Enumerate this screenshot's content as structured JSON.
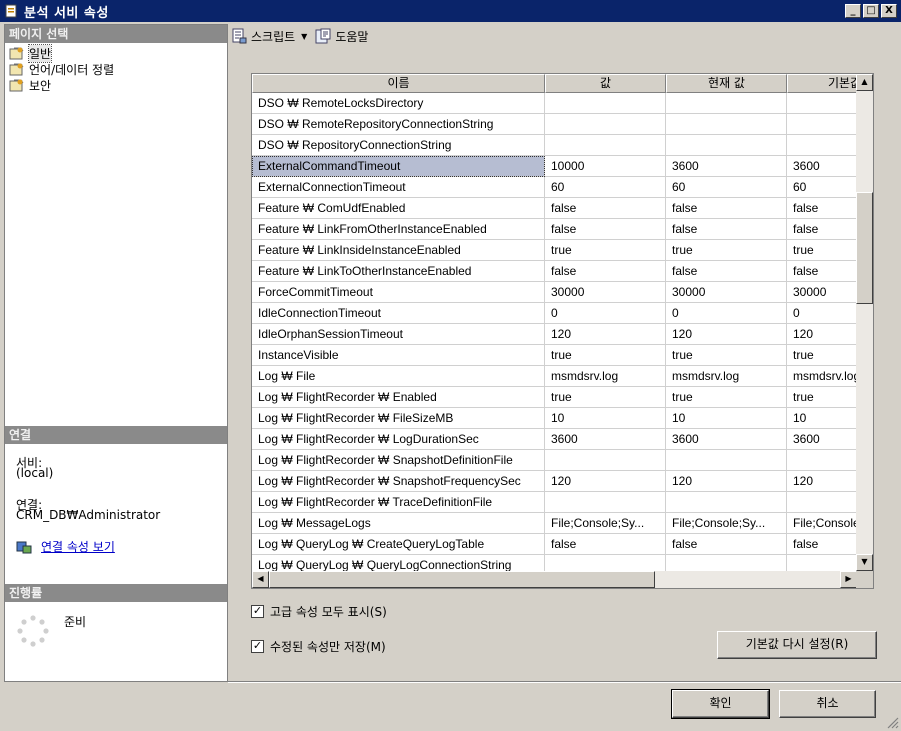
{
  "window": {
    "title": "분석 서비 속성",
    "minimize": "_",
    "maximize": "□",
    "close": "X"
  },
  "left": {
    "pages_header": "페이지 선택",
    "pages": [
      {
        "label": "일반",
        "icon": "property-page-icon"
      },
      {
        "label": "언어/데이터 정렬",
        "icon": "property-page-icon"
      },
      {
        "label": "보안",
        "icon": "property-page-icon"
      }
    ],
    "connection_header": "연결",
    "server_label": "서비:",
    "server_value": "(local)",
    "connection_label": "연결:",
    "connection_value": "CRM_DB₩Administrator",
    "view_connection_link": "연결 속성 보기",
    "progress_header": "진행률",
    "progress_status": "준비"
  },
  "toolbar": {
    "script_label": "스크립트",
    "help_label": "도움말"
  },
  "grid": {
    "columns": [
      "이름",
      "값",
      "현재 값",
      "기본값"
    ],
    "rows": [
      [
        "DSO ₩ RemoteLocksDirectory",
        "",
        "",
        ""
      ],
      [
        "DSO ₩ RemoteRepositoryConnectionString",
        "",
        "",
        ""
      ],
      [
        "DSO ₩ RepositoryConnectionString",
        "",
        "",
        ""
      ],
      [
        "ExternalCommandTimeout",
        "10000",
        "3600",
        "3600"
      ],
      [
        "ExternalConnectionTimeout",
        "60",
        "60",
        "60"
      ],
      [
        "Feature ₩ ComUdfEnabled",
        "false",
        "false",
        "false"
      ],
      [
        "Feature ₩ LinkFromOtherInstanceEnabled",
        "false",
        "false",
        "false"
      ],
      [
        "Feature ₩ LinkInsideInstanceEnabled",
        "true",
        "true",
        "true"
      ],
      [
        "Feature ₩ LinkToOtherInstanceEnabled",
        "false",
        "false",
        "false"
      ],
      [
        "ForceCommitTimeout",
        "30000",
        "30000",
        "30000"
      ],
      [
        "IdleConnectionTimeout",
        "0",
        "0",
        "0"
      ],
      [
        "IdleOrphanSessionTimeout",
        "120",
        "120",
        "120"
      ],
      [
        "InstanceVisible",
        "true",
        "true",
        "true"
      ],
      [
        "Log ₩ File",
        "msmdsrv.log",
        "msmdsrv.log",
        "msmdsrv.log"
      ],
      [
        "Log ₩ FlightRecorder ₩ Enabled",
        "true",
        "true",
        "true"
      ],
      [
        "Log ₩ FlightRecorder ₩ FileSizeMB",
        "10",
        "10",
        "10"
      ],
      [
        "Log ₩ FlightRecorder ₩ LogDurationSec",
        "3600",
        "3600",
        "3600"
      ],
      [
        "Log ₩ FlightRecorder ₩ SnapshotDefinitionFile",
        "",
        "",
        ""
      ],
      [
        "Log ₩ FlightRecorder ₩ SnapshotFrequencySec",
        "120",
        "120",
        "120"
      ],
      [
        "Log ₩ FlightRecorder ₩ TraceDefinitionFile",
        "",
        "",
        ""
      ],
      [
        "Log ₩ MessageLogs",
        "File;Console;Sy...",
        "File;Console;Sy...",
        "File;Console"
      ],
      [
        "Log ₩ QueryLog ₩ CreateQueryLogTable",
        "false",
        "false",
        "false"
      ],
      [
        "Log ₩ QueryLog ₩ QueryLogConnectionString",
        "",
        "",
        ""
      ]
    ],
    "selected_row": 3
  },
  "options": {
    "show_advanced_label": "고급 속성 모두 표시(S)",
    "show_advanced_checked": true,
    "save_modified_label": "수정된 속성만 저장(M)",
    "save_modified_checked": true
  },
  "buttons": {
    "reset": "기본값 다시 설정(R)",
    "ok": "확인",
    "cancel": "취소"
  }
}
